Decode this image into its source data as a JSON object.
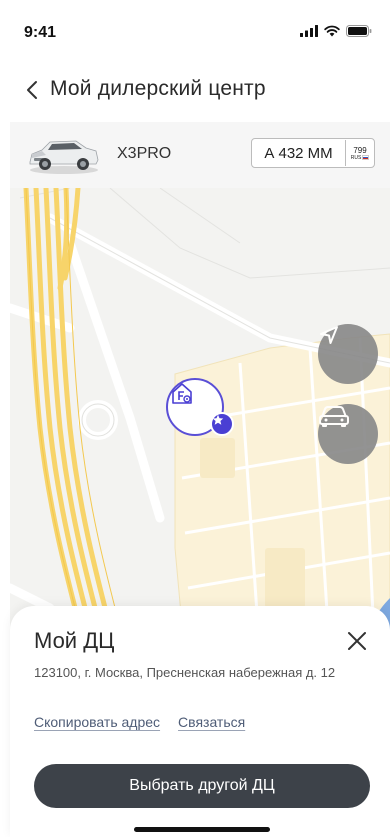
{
  "status_bar": {
    "time": "9:41"
  },
  "header": {
    "title": "Мой дилерский центр",
    "back_icon": "chevron-left-icon"
  },
  "car": {
    "model": "X3PRO",
    "plate_number": "А 432 ММ",
    "plate_region": "799",
    "plate_country": "RUS"
  },
  "map": {
    "locate_icon": "navigation-arrow-icon",
    "car_icon": "car-icon",
    "pin_icon": "dealer-service-icon",
    "pin_badge_icon": "star-icon"
  },
  "sheet": {
    "title": "Мой ДЦ",
    "address": "123100, г. Москва, Пресненская набережная д. 12",
    "copy_link": "Скопировать адрес",
    "contact_link": "Связаться",
    "primary_button": "Выбрать другой ДЦ"
  },
  "colors": {
    "accent": "#4a3fd3",
    "road_major": "#f7d46a",
    "block": "#fbf2d8",
    "button_dark": "#3d4249",
    "fab_gray": "#8a8a8a"
  }
}
